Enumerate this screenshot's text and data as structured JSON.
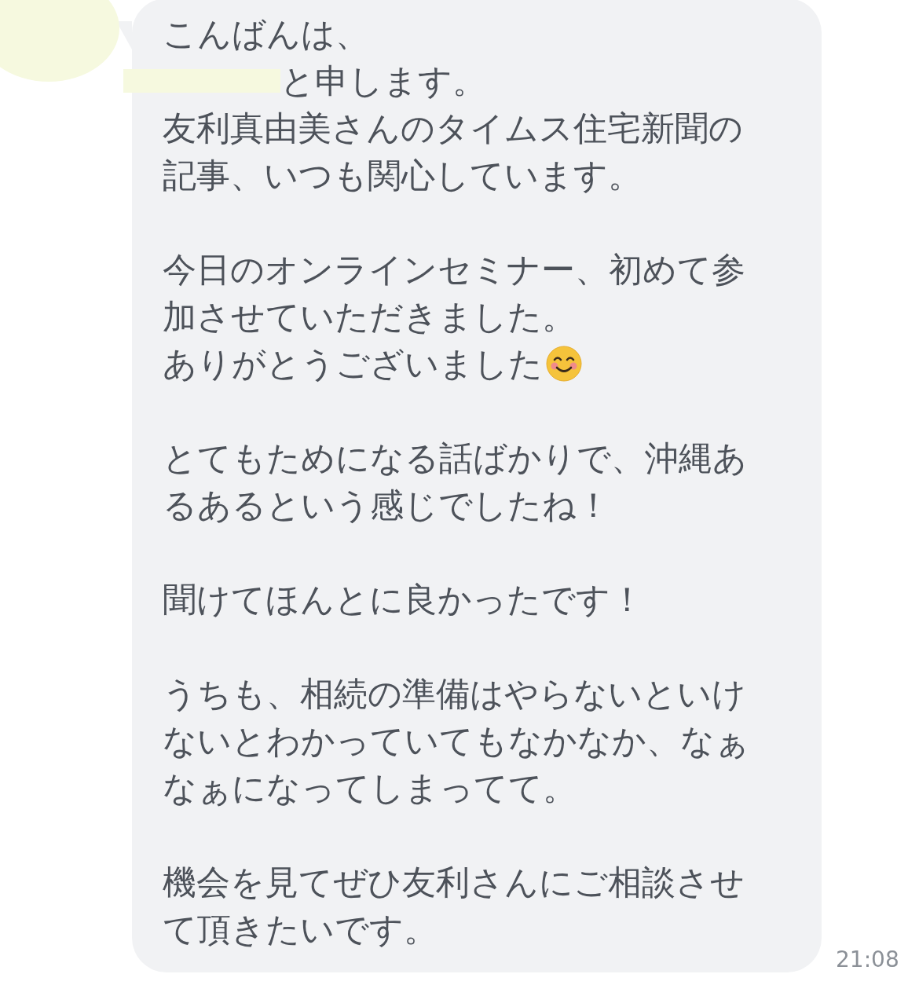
{
  "message": {
    "paragraphs": [
      [
        {
          "text": "こんばんは、",
          "redacted": false
        },
        {
          "text": "と申します。",
          "redacted": true
        },
        {
          "text": "友利真由美さんのタイムス住宅新聞の",
          "redacted": false
        },
        {
          "text": "記事、いつも関心しています。",
          "redacted": false
        }
      ],
      [
        {
          "text": "今日のオンラインセミナー、初めて参",
          "redacted": false
        },
        {
          "text": "加させていただきました。",
          "redacted": false
        },
        {
          "text": "ありがとうございました",
          "redacted": false,
          "emoji": true
        }
      ],
      [
        {
          "text": "とてもためになる話ばかりで、沖縄あ",
          "redacted": false
        },
        {
          "text": "るあるという感じでしたね！",
          "redacted": false
        }
      ],
      [
        {
          "text": "聞けてほんとに良かったです！",
          "redacted": false
        }
      ],
      [
        {
          "text": "うちも、相続の準備はやらないといけ",
          "redacted": false
        },
        {
          "text": "ないとわかっていてもなかなか、なぁ",
          "redacted": false
        },
        {
          "text": "なぁになってしまってて。",
          "redacted": false
        }
      ],
      [
        {
          "text": "機会を見てぜひ友利さんにご相談させ",
          "redacted": false
        },
        {
          "text": "て頂きたいです。",
          "redacted": false
        }
      ]
    ],
    "time": "21:08"
  }
}
